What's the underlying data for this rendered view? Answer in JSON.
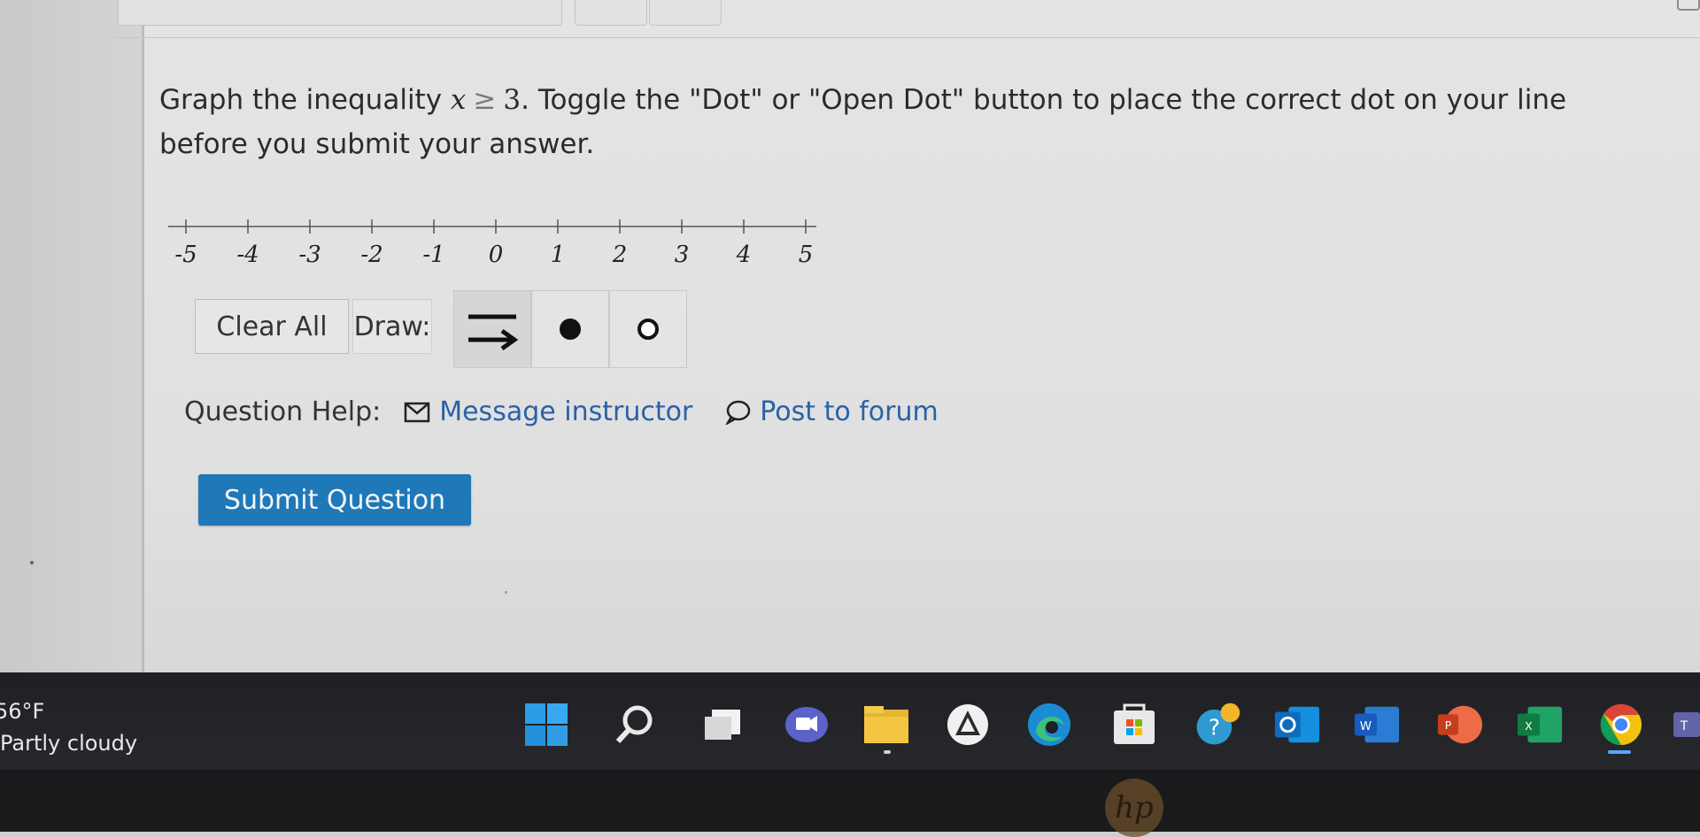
{
  "question": {
    "prefix": "Graph the inequality ",
    "variable": "x",
    "relation": "≥",
    "bound": "3",
    "suffix": ". Toggle the \"Dot\" or \"Open Dot\" button to place the correct dot on your line before you submit your answer."
  },
  "number_line": {
    "min": -5,
    "max": 5,
    "ticks": [
      "-5",
      "-4",
      "-3",
      "-2",
      "-1",
      "0",
      "1",
      "2",
      "3",
      "4",
      "5"
    ]
  },
  "draw_toolbar": {
    "clear_all_label": "Clear All",
    "draw_label": "Draw:",
    "tools": [
      {
        "name": "ray-tool",
        "icon": "ray-arrow-icon",
        "active": true
      },
      {
        "name": "dot-tool",
        "icon": "filled-dot-icon",
        "active": false
      },
      {
        "name": "open-dot-tool",
        "icon": "open-dot-icon",
        "active": false
      }
    ]
  },
  "help": {
    "label": "Question Help:",
    "message_link": "Message instructor",
    "forum_link": "Post to forum"
  },
  "submit": {
    "label": "Submit Question"
  },
  "taskbar": {
    "weather_temp": "56°F",
    "weather_condition": "Partly cloudy",
    "apps": [
      "windows-start-icon",
      "search-icon",
      "task-view-icon",
      "teams-chat-icon",
      "file-explorer-icon",
      "app-store-icon",
      "edge-browser-icon",
      "microsoft-store-icon",
      "help-app-icon",
      "outlook-icon",
      "word-icon",
      "powerpoint-icon",
      "excel-icon",
      "chrome-icon",
      "teams-icon"
    ]
  },
  "colors": {
    "link": "#2a61a8",
    "submit_bg": "#1f78b8"
  }
}
